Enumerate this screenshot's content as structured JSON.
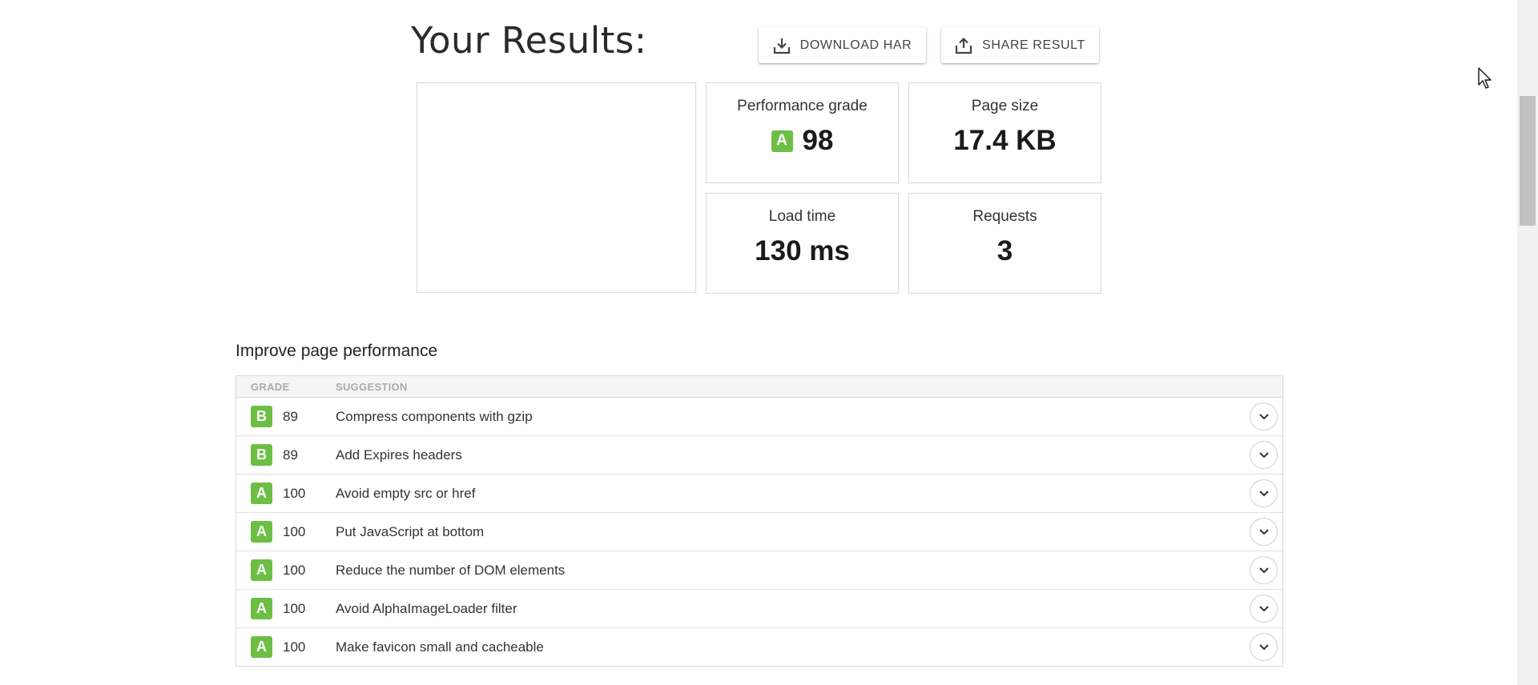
{
  "header": {
    "title": "Your Results:",
    "download_label": "DOWNLOAD HAR",
    "share_label": "SHARE RESULT",
    "download_icon": "download-icon",
    "share_icon": "share-icon"
  },
  "summary": {
    "performance": {
      "label": "Performance grade",
      "grade": "A",
      "value": "98"
    },
    "page_size": {
      "label": "Page size",
      "value": "17.4 KB"
    },
    "load_time": {
      "label": "Load time",
      "value": "130 ms"
    },
    "requests": {
      "label": "Requests",
      "value": "3"
    }
  },
  "improve": {
    "title": "Improve page performance",
    "columns": {
      "grade": "GRADE",
      "suggestion": "SUGGESTION"
    },
    "rows": [
      {
        "grade": "B",
        "score": "89",
        "suggestion": "Compress components with gzip"
      },
      {
        "grade": "B",
        "score": "89",
        "suggestion": "Add Expires headers"
      },
      {
        "grade": "A",
        "score": "100",
        "suggestion": "Avoid empty src or href"
      },
      {
        "grade": "A",
        "score": "100",
        "suggestion": "Put JavaScript at bottom"
      },
      {
        "grade": "A",
        "score": "100",
        "suggestion": "Reduce the number of DOM elements"
      },
      {
        "grade": "A",
        "score": "100",
        "suggestion": "Avoid AlphaImageLoader filter"
      },
      {
        "grade": "A",
        "score": "100",
        "suggestion": "Make favicon small and cacheable"
      }
    ]
  },
  "colors": {
    "grade_badge": "#6cbe45"
  }
}
